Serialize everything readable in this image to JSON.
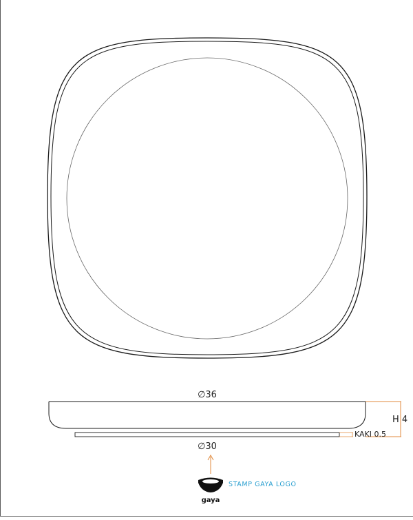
{
  "drawing": {
    "dimensions": {
      "outer_diameter": "∅36",
      "base_diameter": "∅30",
      "height": "H 4",
      "foot": "KAKI 0.5"
    },
    "note": "STAMP GAYA LOGO",
    "logo": {
      "wordmark": "gaya"
    },
    "colors": {
      "line": "#1a1a1a",
      "thin_line": "#555555",
      "dimension_line": "#e08a3c",
      "note": "#2a9fd0"
    }
  }
}
